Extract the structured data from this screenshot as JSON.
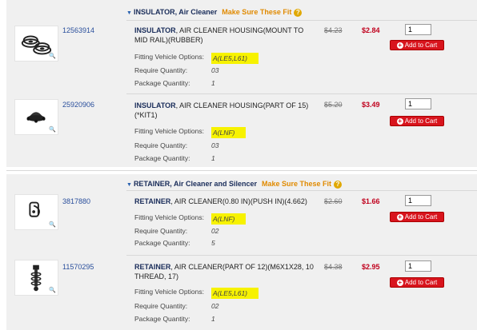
{
  "sections": [
    {
      "category": "INSULATOR, Air Cleaner",
      "fit_link": "Make Sure These Fit",
      "items": [
        {
          "part_number": "12563914",
          "name": "INSULATOR",
          "description": ", AIR CLEANER HOUSING(MOUNT TO MID RAIL)(RUBBER)",
          "fitting_label": "Fitting Vehicle Options:",
          "fitting_value": "A(LE5,L61)",
          "require_label": "Require Quantity:",
          "require_value": "03",
          "package_label": "Package Quantity:",
          "package_value": "1",
          "old_price": "$4.23",
          "price": "$2.84",
          "qty": "1",
          "cart_label": "Add to Cart"
        },
        {
          "part_number": "25920906",
          "name": "INSULATOR",
          "description": ", AIR CLEANER HOUSING(PART OF 15)(*KIT1)",
          "fitting_label": "Fitting Vehicle Options:",
          "fitting_value": "A(LNF)",
          "require_label": "Require Quantity:",
          "require_value": "03",
          "package_label": "Package Quantity:",
          "package_value": "1",
          "old_price": "$5.20",
          "price": "$3.49",
          "qty": "1",
          "cart_label": "Add to Cart"
        }
      ]
    },
    {
      "category": "RETAINER, Air Cleaner and Silencer",
      "fit_link": "Make Sure These Fit",
      "items": [
        {
          "part_number": "3817880",
          "name": "RETAINER",
          "description": ", AIR CLEANER(0.80 IN)(PUSH IN)(4.662)",
          "fitting_label": "Fitting Vehicle Options:",
          "fitting_value": "A(LNF)",
          "require_label": "Require Quantity:",
          "require_value": "02",
          "package_label": "Package Quantity:",
          "package_value": "5",
          "old_price": "$2.60",
          "price": "$1.66",
          "qty": "1",
          "cart_label": "Add to Cart"
        },
        {
          "part_number": "11570295",
          "name": "RETAINER",
          "description": ", AIR CLEANER(PART OF 12)(M6X1X28, 10 THREAD, 17)",
          "fitting_label": "Fitting Vehicle Options:",
          "fitting_value": "A(LE5,L61)",
          "require_label": "Require Quantity:",
          "require_value": "02",
          "package_label": "Package Quantity:",
          "package_value": "1",
          "old_price": "$4.38",
          "price": "$2.95",
          "qty": "1",
          "cart_label": "Add to Cart"
        }
      ]
    }
  ],
  "colors": {
    "price": "#c0001d",
    "accent": "#e08a00",
    "cart": "#d8141d",
    "highlight": "#f7f200"
  }
}
